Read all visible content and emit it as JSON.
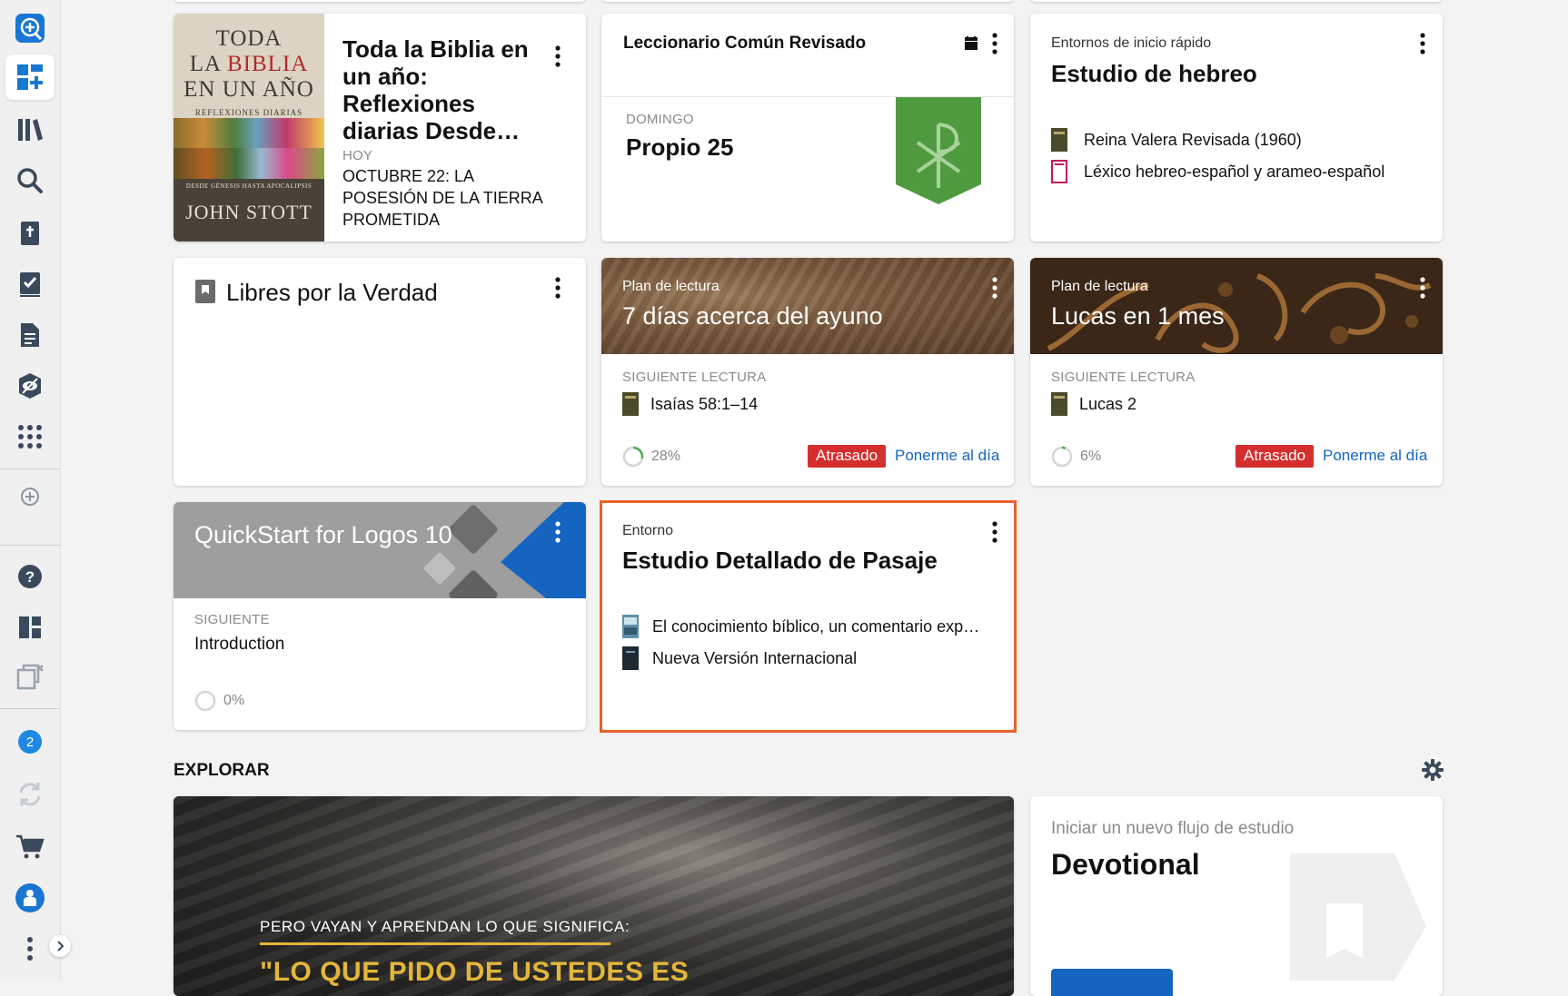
{
  "sidebar": {
    "icons": [
      "new-panel-icon",
      "dashboard-icon",
      "library-icon",
      "search-icon",
      "bible-icon",
      "checklist-icon",
      "document-icon",
      "eye-icon",
      "apps-icon",
      "add-icon",
      "help-icon",
      "layouts-icon",
      "close-panels-icon",
      "notifications-icon",
      "sync-icon",
      "cart-icon",
      "profile-icon",
      "more-icon"
    ],
    "notification_count": "2"
  },
  "cards": {
    "bible_year": {
      "cover": {
        "line1": "TODA",
        "line2a": "LA ",
        "line2b": "BIBLIA",
        "line3": "EN UN AÑO",
        "line4": "REFLEXIONES DIARIAS",
        "line5": "DESDE GÉNESIS HASTA APOCALIPSIS",
        "author": "JOHN STOTT"
      },
      "title": "Toda la Biblia en un año: Reflexiones diarias Desde…",
      "label": "HOY",
      "reading": "OCTUBRE 22: LA POSESIÓN DE LA TIERRA PROMETIDA"
    },
    "lectionary": {
      "title": "Leccionario Común Revisado",
      "day_label": "DOMINGO",
      "day_title": "Propio 25",
      "color": "#4f9a3f"
    },
    "hebrew": {
      "eyebrow": "Entornos de inicio rápido",
      "title": "Estudio de hebreo",
      "resources": [
        "Reina Valera Revisada (1960)",
        "Léxico hebreo-español y arameo-español"
      ]
    },
    "libres": {
      "title": "Libres por la Verdad"
    },
    "fasting": {
      "eyebrow": "Plan de lectura",
      "title": "7 días acerca del ayuno",
      "next_label": "SIGUIENTE LECTURA",
      "next_reading": "Isaías 58:1–14",
      "progress": 28,
      "progress_text": "28%",
      "status": "Atrasado",
      "action": "Ponerme al día"
    },
    "luke": {
      "eyebrow": "Plan de lectura",
      "title": "Lucas en 1 mes",
      "next_label": "SIGUIENTE LECTURA",
      "next_reading": "Lucas 2",
      "progress": 6,
      "progress_text": "6%",
      "status": "Atrasado",
      "action": "Ponerme al día"
    },
    "quickstart": {
      "title": "QuickStart for Logos 10",
      "next_label": "SIGUIENTE",
      "next_item": "Introduction",
      "progress": 0,
      "progress_text": "0%"
    },
    "passage": {
      "eyebrow": "Entorno",
      "title": "Estudio Detallado de Pasaje",
      "resources": [
        "El conocimiento bíblico, un comentario exp…",
        "Nueva Versión Internacional"
      ],
      "highlight_color": "#e8622a"
    }
  },
  "explore": {
    "title": "EXPLORAR",
    "banner_line1": "PERO VAYAN Y APRENDAN LO QUE SIGNIFICA:",
    "banner_line2": "\"LO QUE PIDO DE USTEDES ES",
    "flow_eyebrow": "Iniciar un nuevo flujo de estudio",
    "flow_title": "Devotional"
  },
  "colors": {
    "accent": "#1565c0",
    "danger": "#d32f2f",
    "progress": "#4caf50"
  }
}
